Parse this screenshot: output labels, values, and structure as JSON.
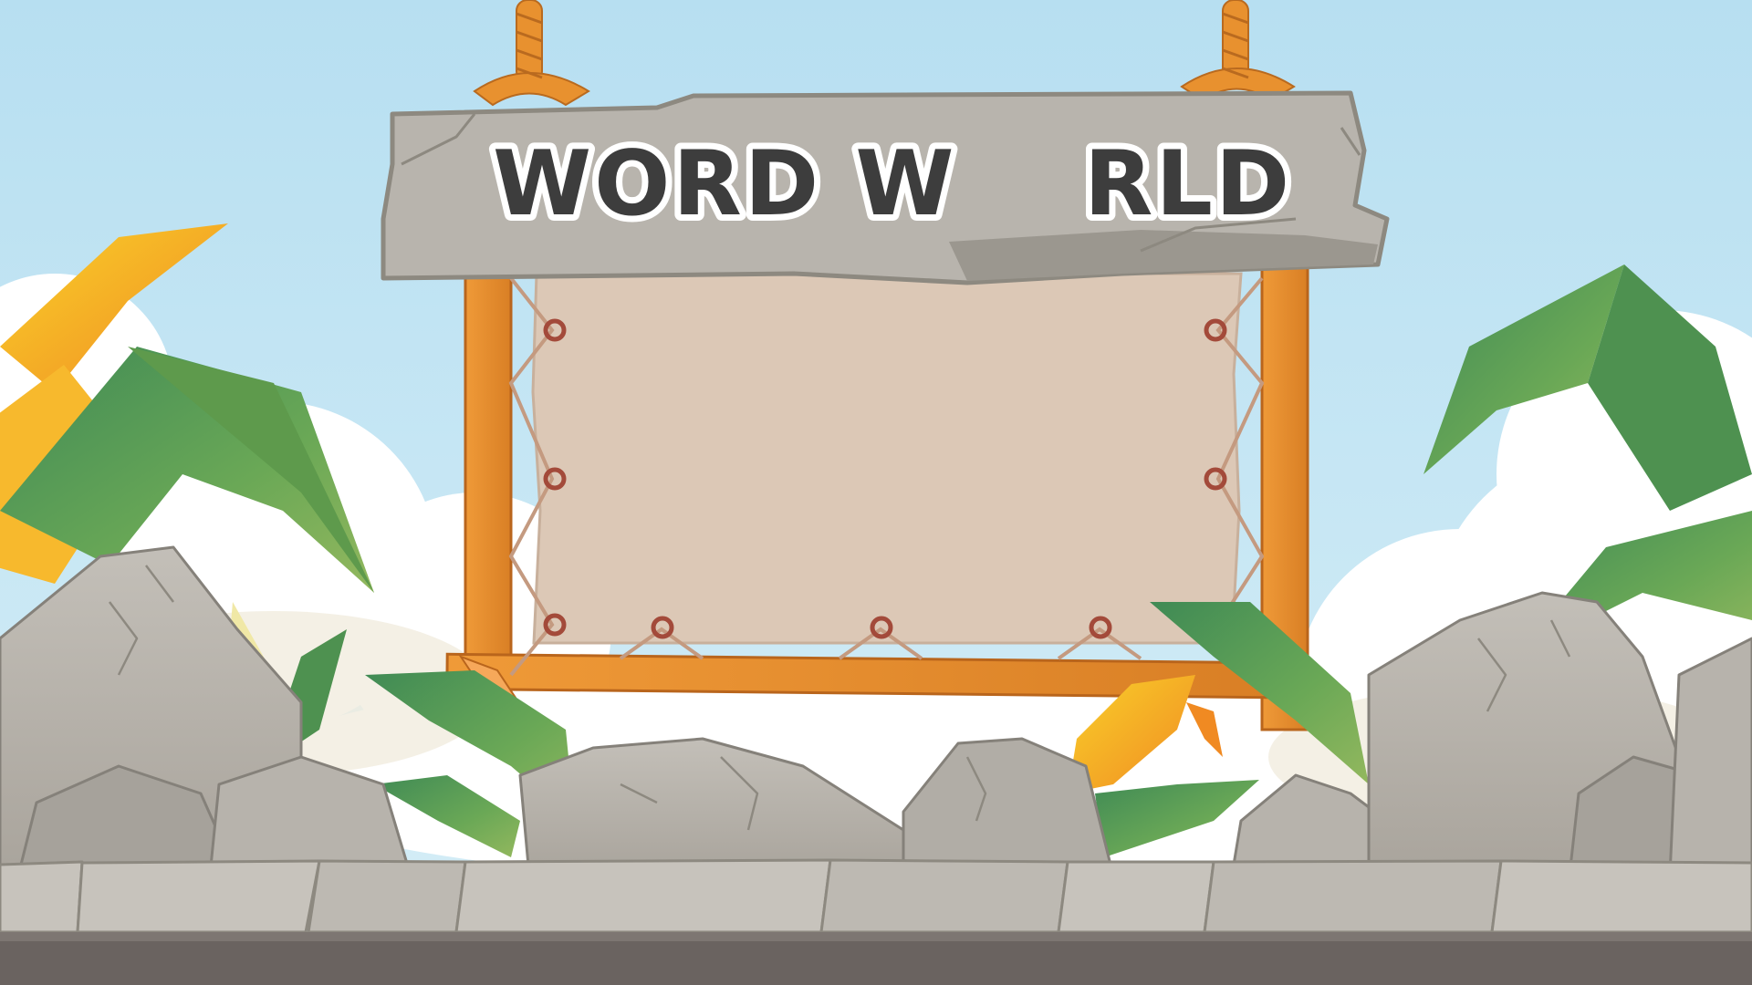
{
  "game": {
    "title_part1": "WORD W",
    "title_part2": "RLD",
    "board_text": ""
  },
  "colors": {
    "sky": "#bfe3f2",
    "stone": "#b9b5ad",
    "stone_dark": "#8d8980",
    "title_fill": "#3d3d3d",
    "wood": "#e48a2c",
    "wood_dark": "#b9651c",
    "parchment": "#dcc8b6",
    "leaf_green": "#5f9f4f",
    "leaf_yellow": "#f5b729",
    "ground": "#6a6360"
  },
  "icons": {
    "hanging_ropes": "rope-icon",
    "grommets": "grommet-icon"
  }
}
